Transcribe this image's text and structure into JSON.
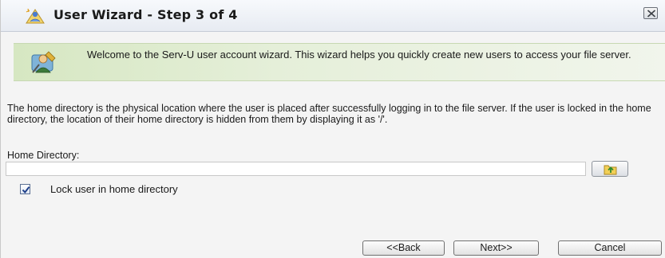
{
  "window": {
    "title": "User Wizard - Step 3 of 4",
    "title_icon": "wizard-icon",
    "close_icon": "close-icon"
  },
  "banner": {
    "icon": "user-wizard-icon",
    "text": "Welcome to the Serv-U user account wizard. This wizard helps you quickly create new users to access your file server.",
    "background": "#dceacc"
  },
  "body": {
    "description": "The home directory is the physical location where the user is placed after successfully logging in to the file server. If the user is locked in the home directory, the location of their home directory is hidden from them by displaying it as '/'.",
    "home_directory": {
      "label": "Home Directory:",
      "value": "",
      "browse_icon": "folder-browse-icon"
    },
    "lock_user": {
      "label": "Lock user in home directory",
      "checked": true
    }
  },
  "buttons": {
    "back": "<<Back",
    "next": "Next>>",
    "cancel": "Cancel"
  }
}
